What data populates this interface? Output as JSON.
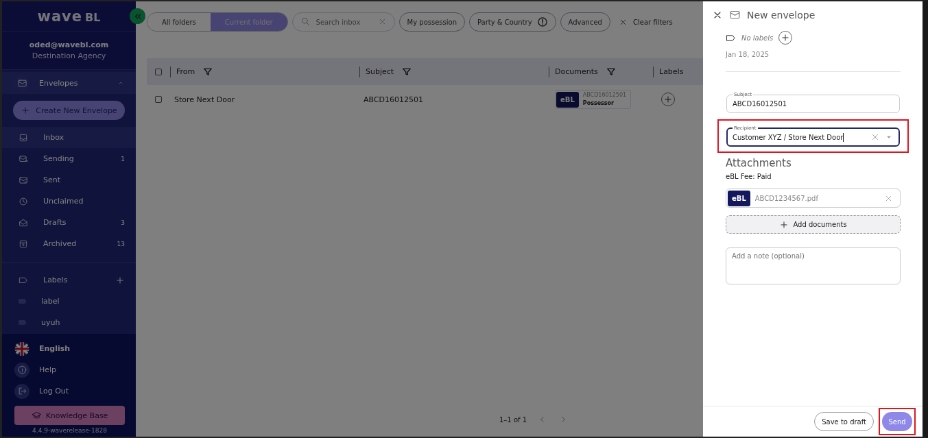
{
  "sidebar": {
    "logo": {
      "word": "wave",
      "suffix": "BL"
    },
    "account": {
      "email": "oded@wavebl.com",
      "organization": "Destination Agency"
    },
    "envelopes": {
      "label": "Envelopes",
      "expanded": true
    },
    "create_button": "Create New Envelope",
    "folders": [
      {
        "kind": "inbox",
        "label": "Inbox",
        "selected": true
      },
      {
        "kind": "sending",
        "label": "Sending",
        "count": "1",
        "selected": false
      },
      {
        "kind": "sent",
        "label": "Sent",
        "selected": false
      },
      {
        "kind": "unclaimed",
        "label": "Unclaimed",
        "selected": false
      },
      {
        "kind": "drafts",
        "label": "Drafts",
        "count": "3",
        "selected": false
      },
      {
        "kind": "archived",
        "label": "Archived",
        "count": "13",
        "selected": false
      }
    ],
    "labels_section": {
      "label": "Labels"
    },
    "labels": [
      {
        "name": "label"
      },
      {
        "name": "uyuh"
      }
    ],
    "footer": [
      {
        "kind": "language",
        "label": "English"
      },
      {
        "kind": "help",
        "label": "Help"
      },
      {
        "kind": "logout",
        "label": "Log Out"
      }
    ],
    "knowledge_button": "Knowledge Base",
    "version": "4.4.9-waverelease-1828"
  },
  "toolbar": {
    "folder_scope": [
      {
        "label": "All folders",
        "selected": false
      },
      {
        "label": "Current folder",
        "selected": true
      }
    ],
    "search": {
      "placeholder": "Search inbox"
    },
    "filters": [
      {
        "label": "My possession",
        "kind": "plain"
      },
      {
        "label": "Party & Country",
        "kind": "warning"
      },
      {
        "label": "Advanced",
        "kind": "plain"
      }
    ],
    "clear_filters": "Clear filters"
  },
  "table": {
    "select_all": {
      "checked": false
    },
    "columns": [
      {
        "label": "From",
        "filter": true
      },
      {
        "label": "Subject",
        "filter": true
      },
      {
        "label": "Documents",
        "filter": true
      },
      {
        "label": "Labels",
        "filter": false
      }
    ],
    "rows": [
      {
        "checked": false,
        "from": "Store Next Door",
        "subject": "ABCD16012501",
        "document": {
          "badge": "eBL",
          "number": "ABCD16012501",
          "role": "Possessor"
        }
      }
    ]
  },
  "pagination": {
    "range": "1–1 of 1"
  },
  "drawer": {
    "title": "New envelope",
    "labels_placeholder": "No labels",
    "date": "Jan 18, 2025",
    "subject": {
      "label": "Subject",
      "value": "ABCD16012501"
    },
    "recipient": {
      "label": "Recipient",
      "value": "Customer XYZ / Store Next Door",
      "highlighted": true
    },
    "attachments_title": "Attachments",
    "fee": "eBL Fee: Paid",
    "attachments": [
      {
        "badge": "eBL",
        "name": "ABCD1234567.pdf"
      }
    ],
    "add_documents": "Add documents",
    "note": {
      "placeholder": "Add a note (optional)"
    },
    "buttons": [
      {
        "label": "Save to draft",
        "kind": "secondary",
        "highlighted": false
      },
      {
        "label": "Send",
        "kind": "primary",
        "highlighted": true
      }
    ]
  }
}
